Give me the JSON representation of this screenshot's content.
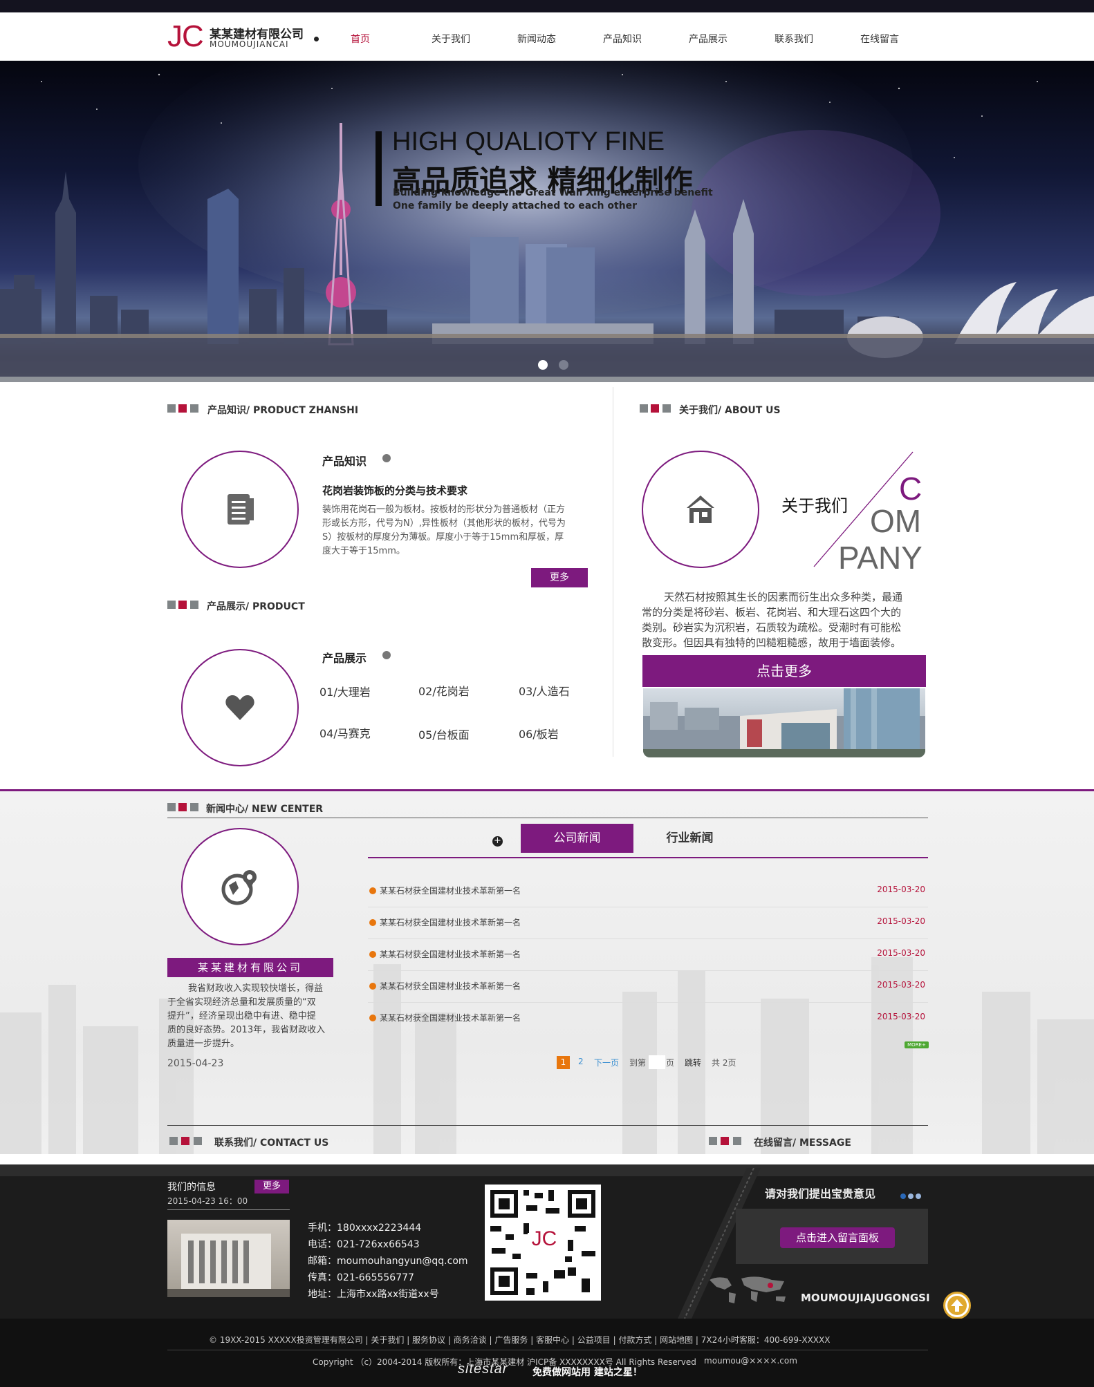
{
  "brand": {
    "logo_mark": "JC",
    "name_cn": "某某建材有限公司",
    "name_en": "MOUMOUJIANCAI",
    "accent": "#b5123a",
    "purple": "#7d1a7e"
  },
  "nav": {
    "items": [
      "首页",
      "关于我们",
      "新闻动态",
      "产品知识",
      "产品展示",
      "联系我们",
      "在线留言"
    ]
  },
  "banner": {
    "title_en": "HIGH QUALIOTY FINE",
    "title_cn": "高品质追求 精细化制作",
    "line1": "Building knowledge the Great Wall Xing enterprise benefit",
    "line2": "One family be deeply attached to each other"
  },
  "product_knowledge": {
    "header": "产品知识/ PRODUCT ZHANSHI",
    "subtitle": "产品知识",
    "article_title": "花岗岩装饰板的分类与技术要求",
    "article_lines": [
      "装饰用花岗石一般为板材。按板材的形状分为普通板材（正方",
      "形或长方形，代号为N）,异性板材（其他形状的板材，代号为",
      "S）按板材的厚度分为薄板。厚度小于等于15mm和厚板，厚",
      "度大于等于15mm。"
    ],
    "more": "更多"
  },
  "product_show": {
    "header": "产品展示/ PRODUCT",
    "subtitle": "产品展示",
    "items": [
      "01/大理岩",
      "02/花岗岩",
      "03/人造石",
      "04/马赛克",
      "05/台板面",
      "06/板岩"
    ]
  },
  "about": {
    "header": "关于我们/ ABOUT US",
    "title": "关于我们",
    "word_c": "C",
    "word_om": "OM",
    "word_pany": "PANY",
    "lines": [
      "天然石材按照其生长的因素而衍生出众多种类，最通",
      "常的分类是将砂岩、板岩、花岗岩、和大理石这四个大的",
      "类别。砂岩实为沉积岩，石质较为疏松。受潮时有可能松",
      "散变形。但因具有独特的凹糙粗糙感，故用于墙面装修。"
    ],
    "button": "点击更多"
  },
  "news": {
    "header": "新闻中心/ NEW CENTER",
    "company_label": "某某建材有限公司",
    "intro_lines": [
      "我省财政收入实现较快增长，得益",
      "于全省实现经济总量和发展质量的“双",
      "提升”，经济呈现出稳中有进、稳中提",
      "质的良好态势。2013年，我省财政收入",
      "质量进一步提升。"
    ],
    "intro_date": "2015-04-23",
    "tab_company": "公司新闻",
    "tab_industry": "行业新闻",
    "rows": [
      {
        "title": "某某石材获全国建材业技术革新第一名",
        "date": "2015-03-20"
      },
      {
        "title": "某某石材获全国建材业技术革新第一名",
        "date": "2015-03-20"
      },
      {
        "title": "某某石材获全国建材业技术革新第一名",
        "date": "2015-03-20"
      },
      {
        "title": "某某石材获全国建材业技术革新第一名",
        "date": "2015-03-20"
      },
      {
        "title": "某某石材获全国建材业技术革新第一名",
        "date": "2015-03-20"
      }
    ],
    "more_tag": "MORE+",
    "pager": {
      "p1": "1",
      "p2": "2",
      "next": "下一页",
      "goto": "到第",
      "page": "页",
      "jump": "跳转",
      "total": "共 2页"
    }
  },
  "contact": {
    "header": "联系我们/ CONTACT US",
    "message_header": "在线留言/ MESSAGE"
  },
  "footer": {
    "info_title": "我们的信息",
    "more": "更多",
    "date": "2015-04-23 16：00",
    "phone": "手机：180xxxx2223444",
    "tel": "电话：021-726xx66543",
    "email": "邮箱：moumouhangyun@qq.com",
    "fax": "传真：021-665556777",
    "address": "地址：上海市xx路xx街道xx号",
    "qr_mark": "JC",
    "msg_title": "请对我们提出宝贵意见",
    "msg_button": "点击进入留言面板",
    "company_en": "MOUMOUJIAJUGONGSI"
  },
  "bottom": {
    "links": "© 19XX-2015 XXXXX投资管理有限公司  |  关于我们  |  服务协议  |  商务洽谈  |  广告服务  |  客服中心  |  公益项目  |  付款方式  |  网站地图  |  7X24小时客服：400-699-XXXXX",
    "copyright": "Copyright （c）2004-2014 版权所有：上海市某某建材 沪ICP备 XXXXXXXX号 All Rights Reserved",
    "email": "moumou@××××.com",
    "sitestar": "sitestar",
    "slogan": "免费做网站用 建站之星！"
  }
}
